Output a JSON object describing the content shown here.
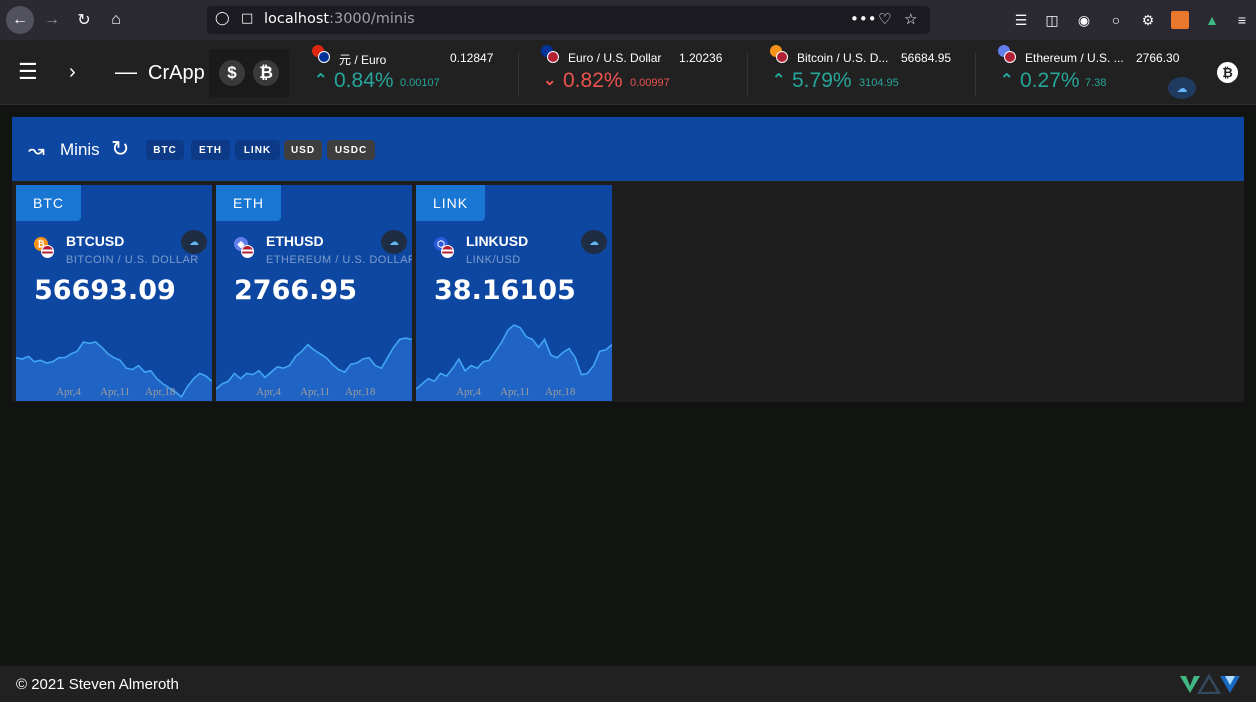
{
  "browser": {
    "url_host": "localhost",
    "url_rest": ":3000/minis"
  },
  "app": {
    "brand": "CrApp",
    "currency_icons": [
      "dollar-icon",
      "bitcoin-icon"
    ]
  },
  "tickers": [
    {
      "name": "元 / Euro",
      "price": "0.12847",
      "pct": "0.84%",
      "change": "0.00107",
      "direction": "up"
    },
    {
      "name": "Euro / U.S. Dollar",
      "price": "1.20236",
      "pct": "0.82%",
      "change": "0.00997",
      "direction": "down"
    },
    {
      "name": "Bitcoin / U.S. D...",
      "price": "56684.95",
      "pct": "5.79%",
      "change": "3104.95",
      "direction": "up"
    },
    {
      "name": "Ethereum / U.S. ...",
      "price": "2766.30",
      "pct": "0.27%",
      "change": "7.38",
      "direction": "up"
    }
  ],
  "panel": {
    "title": "Minis",
    "chips": [
      {
        "label": "BTC",
        "active": true
      },
      {
        "label": "ETH",
        "active": true
      },
      {
        "label": "LINK",
        "active": true
      },
      {
        "label": "USD",
        "active": false
      },
      {
        "label": "USDC",
        "active": false
      }
    ]
  },
  "cards": [
    {
      "tab": "BTC",
      "symbol": "BTCUSD",
      "subtitle": "BITCOIN / U.S. DOLLAR",
      "price": "56693.09",
      "x_labels": [
        "Apr,4",
        "Apr,11",
        "Apr,18"
      ],
      "series": [
        30,
        29,
        31,
        27,
        28,
        26,
        27,
        30,
        30,
        33,
        35,
        42,
        41,
        42,
        38,
        33,
        30,
        28,
        22,
        21,
        24,
        19,
        20,
        14,
        10,
        7,
        4,
        0,
        8,
        14,
        18,
        16,
        12
      ]
    },
    {
      "tab": "ETH",
      "symbol": "ETHUSD",
      "subtitle": "ETHEREUM / U.S. DOLLAR",
      "price": "2766.95",
      "x_labels": [
        "Apr,4",
        "Apr,11",
        "Apr,18"
      ],
      "series": [
        6,
        10,
        12,
        18,
        14,
        18,
        17,
        20,
        15,
        19,
        23,
        22,
        24,
        31,
        35,
        40,
        36,
        33,
        30,
        25,
        21,
        19,
        25,
        26,
        29,
        30,
        24,
        22,
        30,
        38,
        44,
        45,
        44
      ]
    },
    {
      "tab": "LINK",
      "symbol": "LINKUSD",
      "subtitle": "LINK/USD",
      "price": "38.16105",
      "x_labels": [
        "Apr,4",
        "Apr,11",
        "Apr,18"
      ],
      "series": [
        6,
        10,
        14,
        12,
        18,
        16,
        22,
        29,
        20,
        24,
        22,
        27,
        28,
        35,
        42,
        51,
        55,
        53,
        46,
        44,
        38,
        44,
        32,
        30,
        34,
        37,
        30,
        17,
        18,
        24,
        35,
        36,
        40
      ]
    }
  ],
  "footer": {
    "copyright": "© 2021 Steven Almeroth"
  }
}
